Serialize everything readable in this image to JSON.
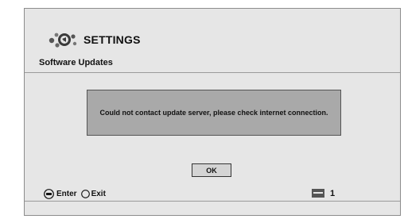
{
  "header": {
    "title": "SETTINGS",
    "logo_icon": "settings-gear-cluster-icon"
  },
  "section": {
    "label": "Software Updates"
  },
  "dialog": {
    "message": "Could not contact update server, please check internet connection.",
    "ok_label": "OK"
  },
  "footer": {
    "enter_label": "Enter",
    "enter_icon": "enter-button-icon",
    "exit_label": "Exit",
    "exit_icon": "exit-circle-icon",
    "tray_icon": "disc-tray-icon",
    "tray_value": "1"
  },
  "colors": {
    "panel": "#e6e6e6",
    "dialog": "#a9a9a9",
    "button": "#d4d4d4",
    "text": "#111111"
  }
}
